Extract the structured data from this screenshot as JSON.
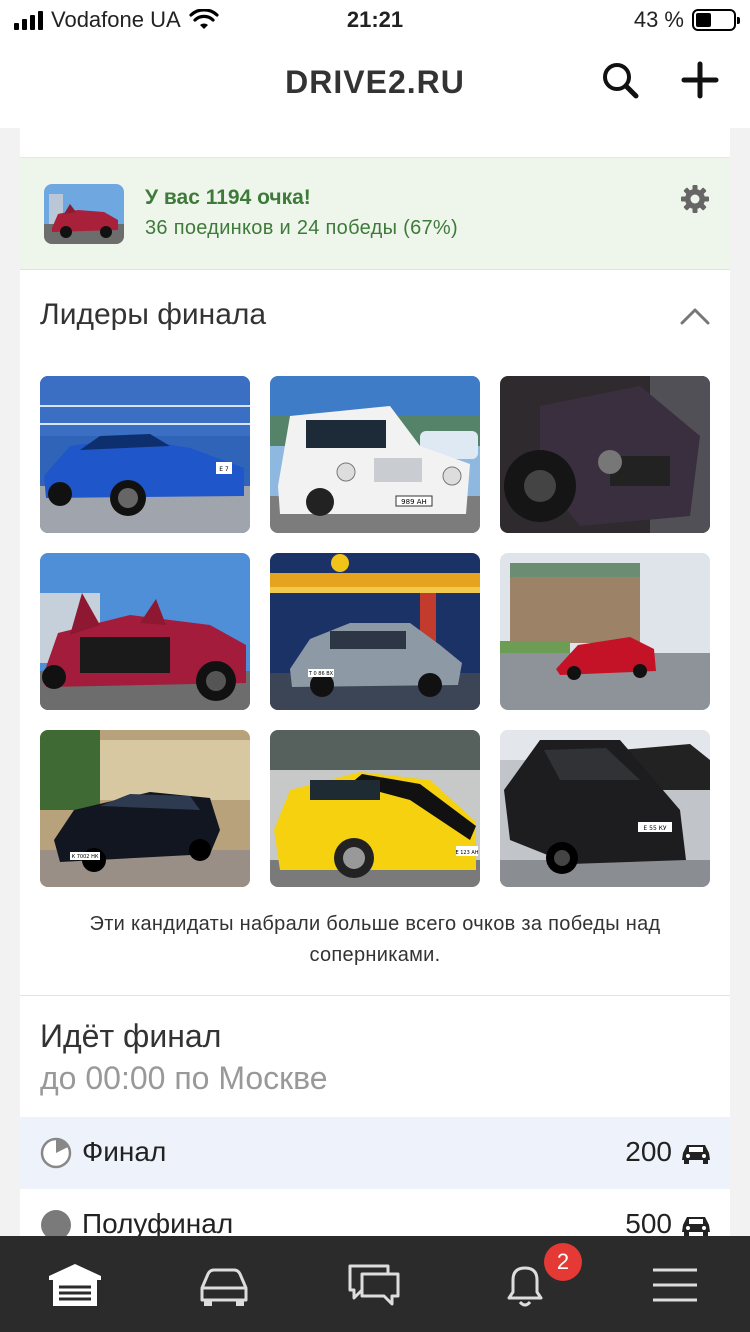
{
  "status_bar": {
    "carrier": "Vodafone UA",
    "time": "21:21",
    "battery": "43 %",
    "battery_level": 0.43
  },
  "header": {
    "title": "DRIVE2.RU"
  },
  "score": {
    "title": "У вас 1194 очка!",
    "subtitle": "36 поединков и 24 победы (67%)"
  },
  "leaders": {
    "title": "Лидеры финала",
    "note": "Эти кандидаты набрали больше всего очков за победы над соперниками.",
    "photos": [
      {
        "plate": "Е 7"
      },
      {
        "plate": "989 АН"
      },
      {
        "plate": ""
      },
      {
        "plate": ""
      },
      {
        "plate": "Т 0 86 ВХ"
      },
      {
        "plate": ""
      },
      {
        "plate": "К 7002 НК"
      },
      {
        "plate": "Е 123 АН"
      },
      {
        "plate": "Е 55 КУ"
      }
    ]
  },
  "final": {
    "title": "Идёт финал",
    "subtitle": "до 00:00 по Москве",
    "stages": [
      {
        "label": "Финал",
        "value": "200"
      },
      {
        "label": "Полуфинал",
        "value": "500"
      }
    ]
  },
  "tabbar": {
    "notifications_badge": "2"
  },
  "colors": {
    "score_bg": "#eef6ec",
    "score_text": "#3f7a3a",
    "active_row": "#eef3fb",
    "tabbar_bg": "#2b2b2b",
    "badge": "#e53935"
  }
}
